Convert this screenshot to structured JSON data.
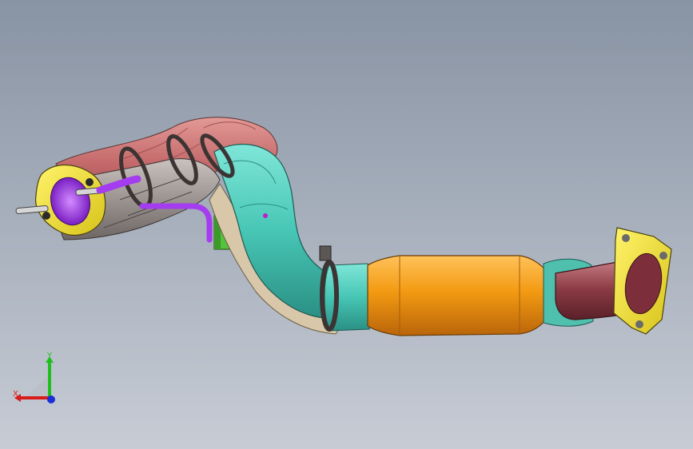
{
  "viewport": {
    "background_top": "#8893a3",
    "background_bottom": "#c7ccd5"
  },
  "model": {
    "colors": {
      "flange": "#f2e22a",
      "pipe_teal": "#52d3c2",
      "converter_orange": "#f39a12",
      "heat_shield_red": "#c4686a",
      "tube_purple": "#a43cf0",
      "bracket_green": "#55c23b",
      "clamp_dark": "#3b3433",
      "gasket_tan": "#d8c7a8",
      "rear_pipe_maroon": "#8a3a44"
    }
  },
  "triad": {
    "x_label": "X",
    "y_label": "Y",
    "x_color": "#d81b1b",
    "y_color": "#1ec01e",
    "z_color": "#1b2fd8"
  }
}
